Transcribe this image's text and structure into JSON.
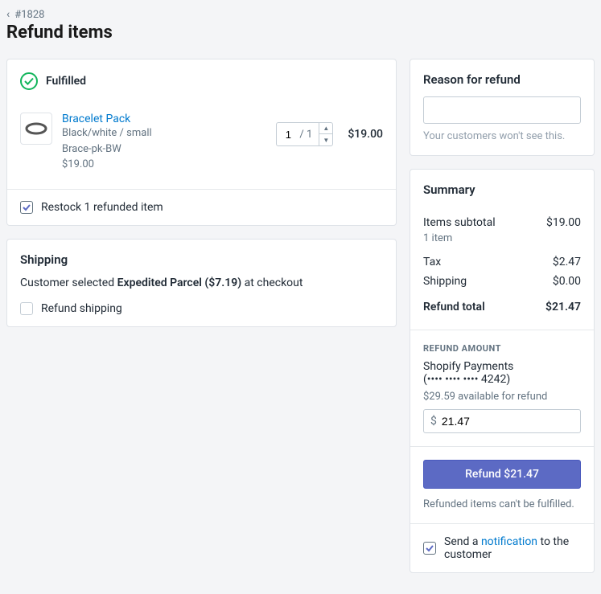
{
  "breadcrumb": {
    "order_num": "#1828"
  },
  "page": {
    "title": "Refund items"
  },
  "fulfilled": {
    "label": "Fulfilled",
    "item": {
      "name": "Bracelet Pack",
      "variant": "Black/white / small",
      "sku": "Brace-pk-BW",
      "unit_price": "$19.00",
      "qty": "1",
      "qty_max": "/ 1",
      "line_price": "$19.00"
    },
    "restock": {
      "checked": true,
      "label": "Restock 1 refunded item"
    }
  },
  "shipping": {
    "heading": "Shipping",
    "line_prefix": "Customer selected ",
    "method": "Expedited Parcel ($7.19)",
    "line_suffix": " at checkout",
    "refund_checked": false,
    "refund_label": "Refund shipping"
  },
  "reason": {
    "heading": "Reason for refund",
    "value": "",
    "help": "Your customers won't see this."
  },
  "summary": {
    "heading": "Summary",
    "items_subtotal_label": "Items subtotal",
    "items_subtotal": "$19.00",
    "item_count": "1 item",
    "tax_label": "Tax",
    "tax": "$2.47",
    "shipping_label": "Shipping",
    "shipping": "$0.00",
    "total_label": "Refund total",
    "total": "$21.47"
  },
  "refund_amount": {
    "label": "REFUND AMOUNT",
    "gateway": "Shopify Payments",
    "card": "(•••• •••• •••• 4242)",
    "available": "$29.59 available for refund",
    "currency": "$",
    "value": "21.47",
    "button": "Refund $21.47",
    "note": "Refunded items can't be fulfilled.",
    "notify_prefix": "Send a ",
    "notify_link": "notification",
    "notify_suffix": " to the customer",
    "notify_checked": true
  }
}
